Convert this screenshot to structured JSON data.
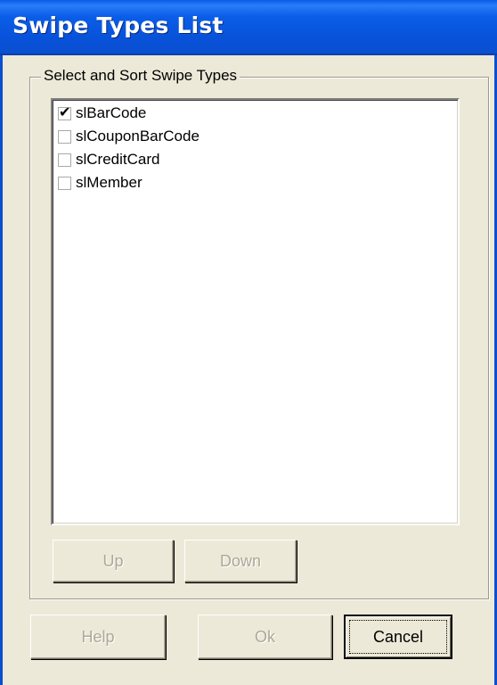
{
  "window": {
    "title": "Swipe Types List"
  },
  "group": {
    "caption": "Select and Sort Swipe Types"
  },
  "list": {
    "items": [
      {
        "label": "slBarCode",
        "checked": true
      },
      {
        "label": "slCouponBarCode",
        "checked": false
      },
      {
        "label": "slCreditCard",
        "checked": false
      },
      {
        "label": "slMember",
        "checked": false
      }
    ],
    "check_glyph": "✔"
  },
  "buttons": {
    "up": "Up",
    "down": "Down",
    "help": "Help",
    "ok": "Ok",
    "cancel": "Cancel"
  },
  "colors": {
    "titlebar": "#0a5ce6",
    "face": "#ece9d8",
    "disabled_text": "#aca899"
  }
}
